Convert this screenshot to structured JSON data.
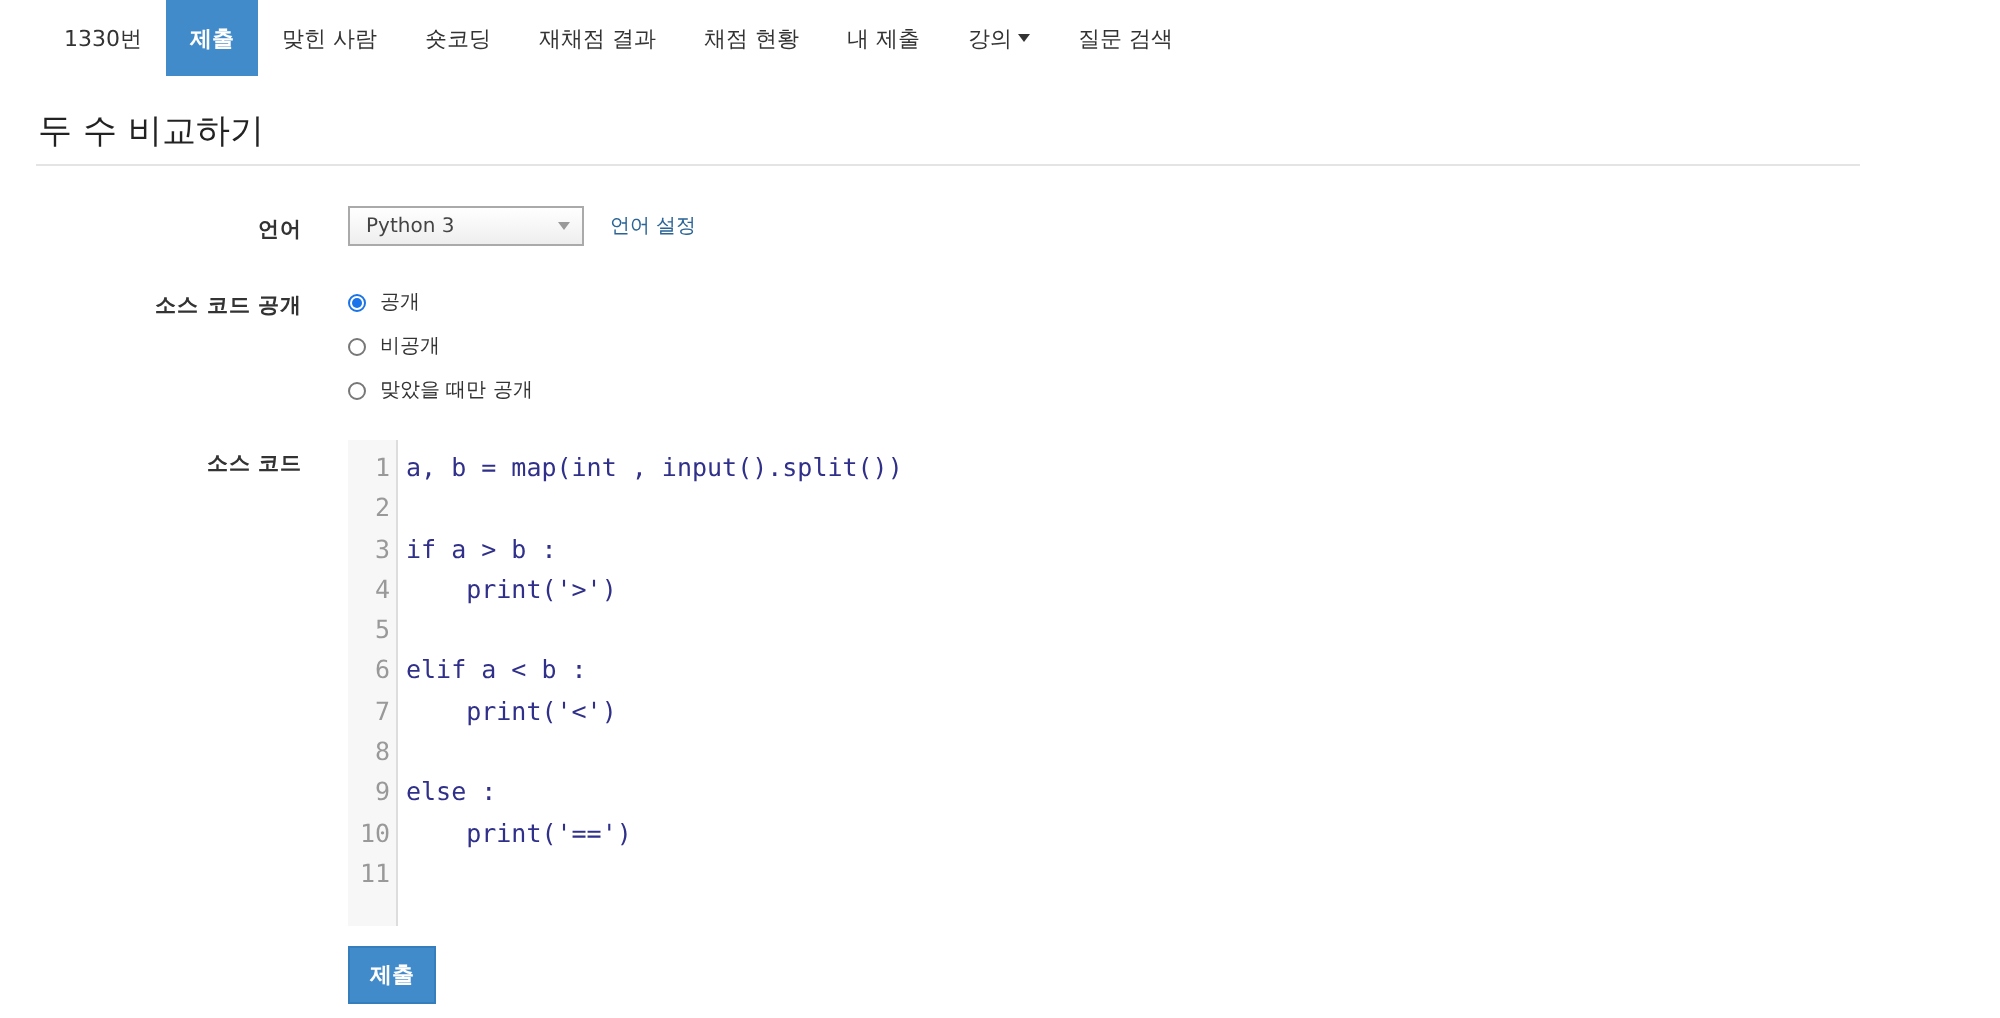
{
  "tabs": [
    {
      "label": "1330번",
      "selected": false
    },
    {
      "label": "제출",
      "selected": true
    },
    {
      "label": "맞힌 사람",
      "selected": false
    },
    {
      "label": "숏코딩",
      "selected": false
    },
    {
      "label": "재채점 결과",
      "selected": false
    },
    {
      "label": "채점 현황",
      "selected": false
    },
    {
      "label": "내 제출",
      "selected": false
    },
    {
      "label": "강의",
      "selected": false,
      "dropdown": true
    },
    {
      "label": "질문 검색",
      "selected": false
    }
  ],
  "title": "두 수 비교하기",
  "language": {
    "label": "언어",
    "value": "Python 3",
    "link": "언어 설정"
  },
  "visibility": {
    "label": "소스 코드 공개",
    "options": [
      {
        "label": "공개",
        "selected": true
      },
      {
        "label": "비공개",
        "selected": false
      },
      {
        "label": "맞았을 때만 공개",
        "selected": false
      }
    ]
  },
  "source": {
    "label": "소스 코드",
    "lines": [
      {
        "number": "1",
        "text": "a, b = map(int , input().split())"
      },
      {
        "number": "2"
      },
      {
        "number": "3",
        "text": "if a > b :"
      },
      {
        "number": "4",
        "text": "    print('>')"
      },
      {
        "number": "5"
      },
      {
        "number": "6",
        "text": "elif a < b :"
      },
      {
        "number": "7",
        "text": "    print('<')"
      },
      {
        "number": "8"
      },
      {
        "number": "9",
        "text": "else :"
      },
      {
        "number": "10",
        "text": "    print('==')"
      },
      {
        "number": "11"
      }
    ]
  },
  "submit": "제출"
}
